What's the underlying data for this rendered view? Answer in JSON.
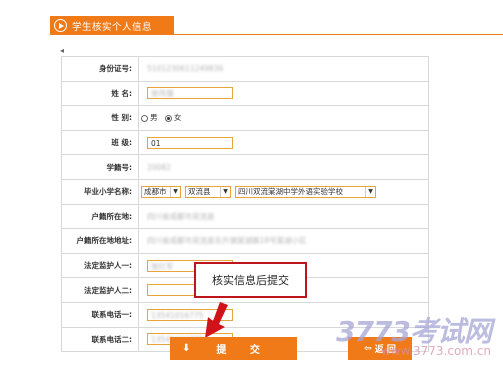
{
  "header": {
    "title": "学生核实个人信息",
    "icon": "play-circle-icon"
  },
  "back": "◂",
  "form": {
    "rows": [
      {
        "key": "id",
        "label": "身份证号:",
        "value": "5101230611249836"
      },
      {
        "key": "name",
        "label": "姓  名:",
        "value": "张伟强"
      },
      {
        "key": "gender",
        "label": "性  别:",
        "options": [
          "男",
          "女"
        ],
        "selected": "女"
      },
      {
        "key": "class",
        "label": "班  级:",
        "value": "01"
      },
      {
        "key": "student_no",
        "label": "学籍号:",
        "value": "20082"
      },
      {
        "key": "school",
        "label": "毕业小学名称:",
        "city": "成都市",
        "county": "双流县",
        "school": "四川双流棠湖中学外语实验学校"
      },
      {
        "key": "hukou",
        "label": "户籍所在地:",
        "value": "四川省成都市双流县"
      },
      {
        "key": "address",
        "label": "户籍所在地地址:",
        "value": "四川省成都市双流县东升镇棠湖路18号棠湖小区"
      },
      {
        "key": "guardian1",
        "label": "法定监护人一:",
        "value": "张红军"
      },
      {
        "key": "guardian2",
        "label": "法定监护人二:",
        "value": ""
      },
      {
        "key": "phone1",
        "label": "联系电话一:",
        "value": "13541016775"
      },
      {
        "key": "phone2",
        "label": "联系电话二:",
        "value": "13541016779"
      }
    ]
  },
  "callout": "核实信息后提交",
  "buttons": {
    "submit": "提 交",
    "return": "返 回",
    "submit_icon": "down-arrow-icon",
    "return_icon": "return-arrow-icon"
  },
  "watermark": {
    "main": "3773考试网",
    "sub": "www.3773.com.cn"
  },
  "colors": {
    "accent": "#f07a18",
    "callout_border": "#c0141c",
    "input_border": "#e8a33a"
  }
}
